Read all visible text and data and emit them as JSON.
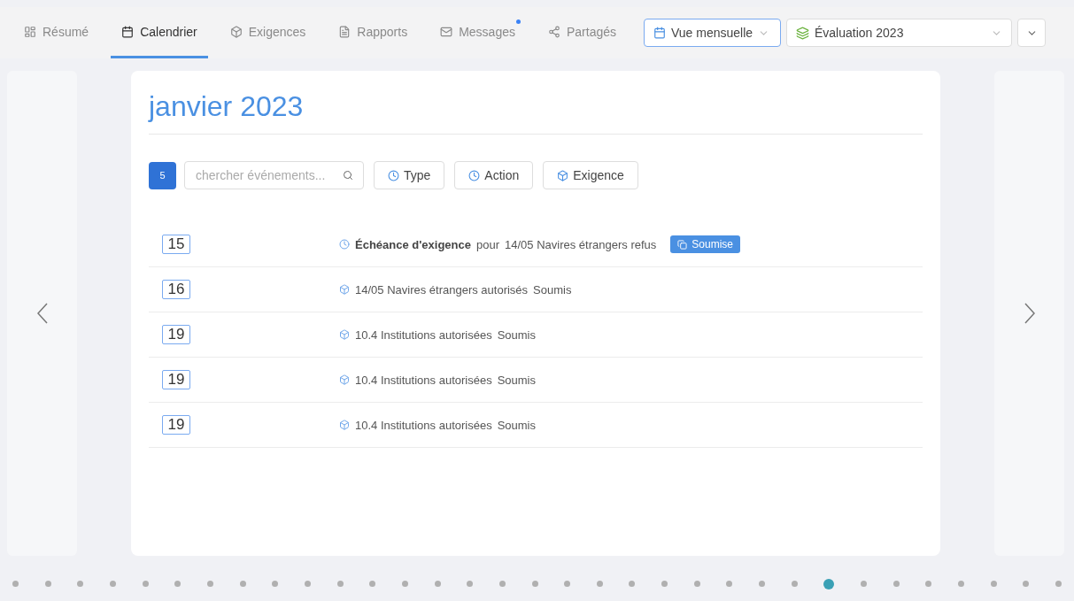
{
  "tabs": [
    {
      "label": "Résumé",
      "selected": false,
      "notification": false
    },
    {
      "label": "Calendrier",
      "selected": true,
      "notification": false
    },
    {
      "label": "Exigences",
      "selected": false,
      "notification": false
    },
    {
      "label": "Rapports",
      "selected": false,
      "notification": false
    },
    {
      "label": "Messages",
      "selected": false,
      "notification": true
    },
    {
      "label": "Partagés",
      "selected": false,
      "notification": false
    }
  ],
  "view_select": {
    "value": "Vue mensuelle",
    "focused": true
  },
  "plan_select": {
    "value": "Évaluation 2023",
    "focused": false
  },
  "month_title": "janvier 2023",
  "toolbar": {
    "count": "5",
    "search": {
      "placeholder": "chercher événements..."
    },
    "filters": [
      "Type",
      "Action",
      "Exigence"
    ]
  },
  "events": [
    {
      "kind": "deadline",
      "day": "15",
      "title": "Échéance d'exigence",
      "connector": "pour",
      "subject": "14/05 Navires étrangers refus",
      "badge": "Soumise"
    },
    {
      "kind": "requirement",
      "day": "16",
      "subject": "14/05 Navires étrangers autorisés",
      "status": "Soumis"
    },
    {
      "kind": "requirement",
      "day": "19",
      "subject": "10.4 Institutions autorisées",
      "status": "Soumis"
    },
    {
      "kind": "requirement",
      "day": "19",
      "subject": "10.4 Institutions autorisées",
      "status": "Soumis"
    },
    {
      "kind": "requirement",
      "day": "19",
      "subject": "10.4 Institutions autorisées",
      "status": "Soumis"
    }
  ],
  "pagination": [
    {
      "selected": false
    },
    {
      "selected": false
    },
    {
      "selected": false
    },
    {
      "selected": false
    },
    {
      "selected": false
    },
    {
      "selected": false
    },
    {
      "selected": false
    },
    {
      "selected": false
    },
    {
      "selected": false
    },
    {
      "selected": false
    },
    {
      "selected": false
    },
    {
      "selected": false
    },
    {
      "selected": false
    },
    {
      "selected": false
    },
    {
      "selected": false
    },
    {
      "selected": false
    },
    {
      "selected": false
    },
    {
      "selected": false
    },
    {
      "selected": false
    },
    {
      "selected": false
    },
    {
      "selected": false
    },
    {
      "selected": false
    },
    {
      "selected": false
    },
    {
      "selected": false
    },
    {
      "selected": false
    },
    {
      "selected": true
    },
    {
      "selected": false
    },
    {
      "selected": false
    },
    {
      "selected": false
    },
    {
      "selected": false
    },
    {
      "selected": false
    },
    {
      "selected": false
    },
    {
      "selected": false
    }
  ]
}
